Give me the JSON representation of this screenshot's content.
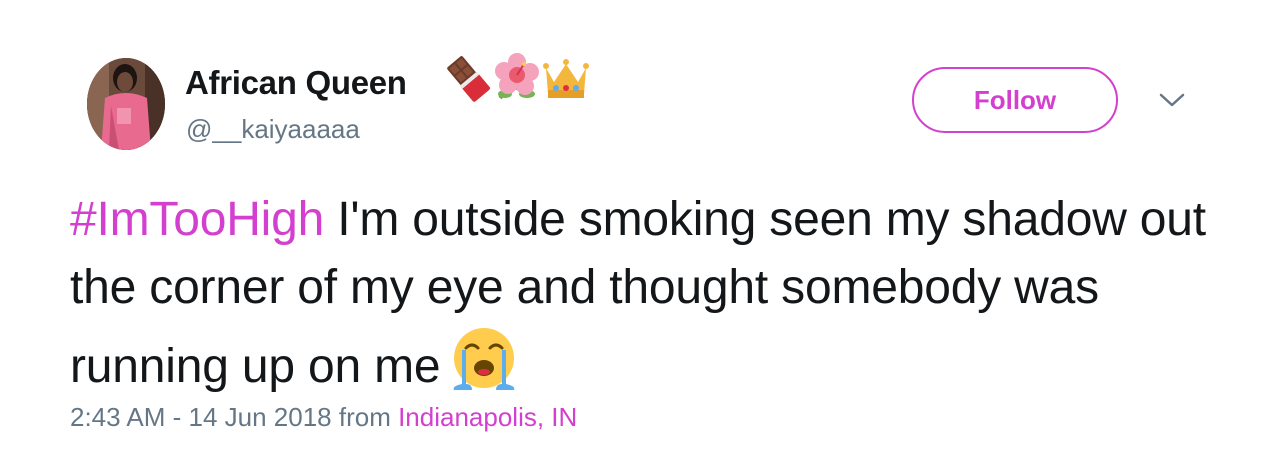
{
  "user": {
    "name": "African Queen",
    "handle": "@__kaiyaaaaa",
    "name_emojis": [
      "chocolate-bar-icon",
      "hibiscus-icon",
      "crown-icon"
    ]
  },
  "follow": {
    "label": "Follow"
  },
  "menu": {
    "icon": "chevron-down-icon"
  },
  "tweet": {
    "hashtag": "#ImTooHigh",
    "body": " I'm outside smoking seen my shadow out the corner of my eye and thought somebody was running up on me",
    "emoji": "loudly-crying-face-icon"
  },
  "meta": {
    "time": "2:43 AM - 14 Jun 2018",
    "from": " from ",
    "location": "Indianapolis, IN"
  },
  "colors": {
    "accent": "#d33fce",
    "text": "#14171a",
    "muted": "#657786"
  }
}
